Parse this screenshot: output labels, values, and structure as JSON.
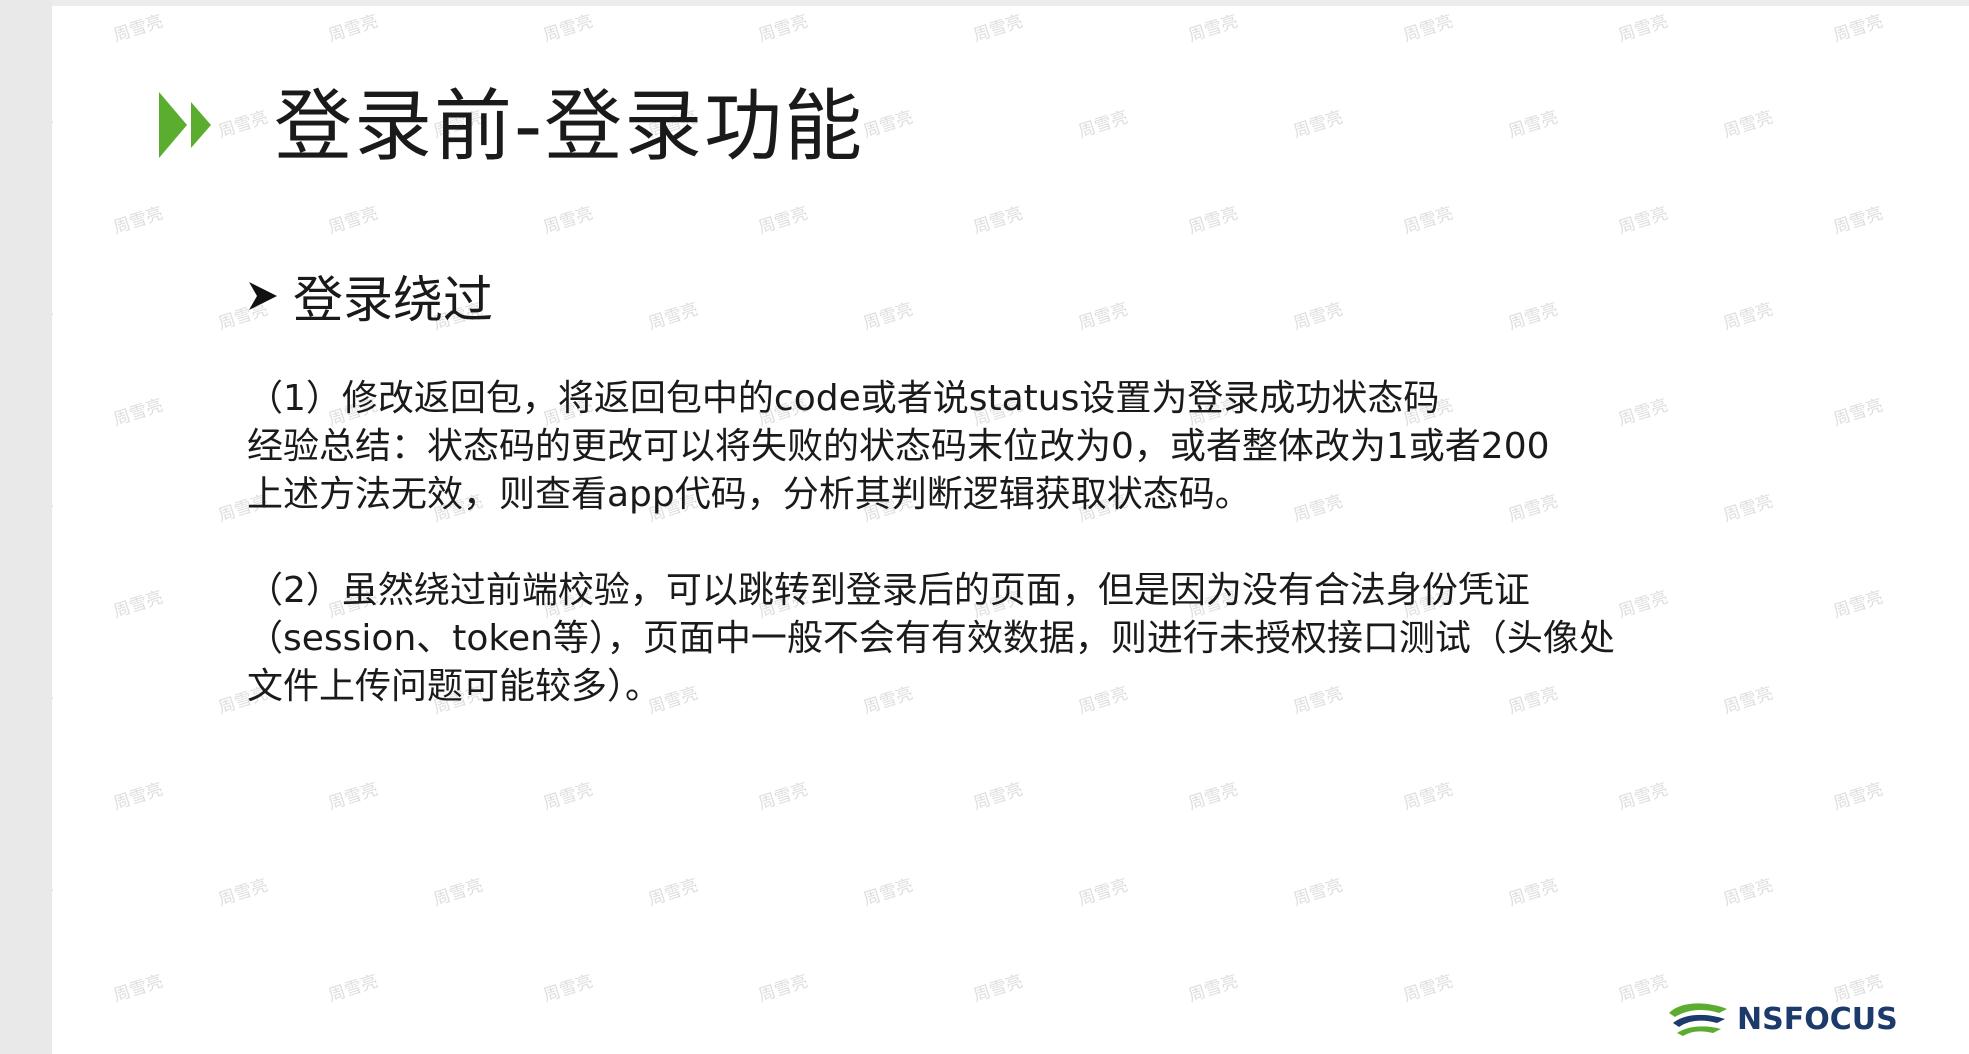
{
  "slide": {
    "title": "登录前-登录功能",
    "section_heading": "登录绕过",
    "paragraph1": [
      "（1）修改返回包，将返回包中的code或者说status设置为登录成功状态码",
      "经验总结：状态码的更改可以将失败的状态码末位改为0，或者整体改为1或者200",
      "上述方法无效，则查看app代码，分析其判断逻辑获取状态码。"
    ],
    "paragraph2": [
      "（2）虽然绕过前端校验，可以跳转到登录后的页面，但是因为没有合法身份凭证",
      "（session、token等），页面中一般不会有有效数据，则进行未授权接口测试（头像处",
      "文件上传问题可能较多）。"
    ],
    "watermark_text": "周雪亮",
    "logo_text": "NSFOCUS"
  },
  "colors": {
    "accent_green": "#5aad2f",
    "logo_blue": "#1c3a6b",
    "text": "#1a1a1a"
  },
  "icons": {
    "title_marker": "double-chevron-right-icon",
    "section_bullet": "arrow-bullet-icon",
    "logo": "nsfocus-logo-icon"
  }
}
